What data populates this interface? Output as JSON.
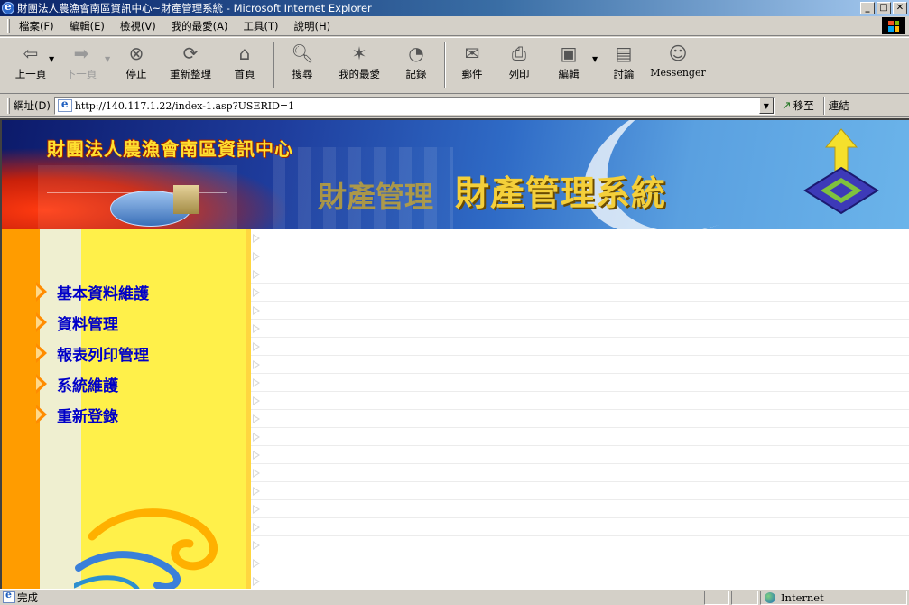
{
  "window": {
    "title": "財團法人農漁會南區資訊中心~財產管理系統 - Microsoft Internet Explorer",
    "controls": {
      "minimize": "_",
      "maximize": "□",
      "close": "✕"
    }
  },
  "menu": {
    "items": [
      "檔案(F)",
      "編輯(E)",
      "檢視(V)",
      "我的最愛(A)",
      "工具(T)",
      "說明(H)"
    ]
  },
  "toolbar": {
    "back": "上一頁",
    "forward": "下一頁",
    "stop": "停止",
    "refresh": "重新整理",
    "home": "首頁",
    "search": "搜尋",
    "favorites": "我的最愛",
    "history": "記錄",
    "mail": "郵件",
    "print": "列印",
    "edit": "編輯",
    "discuss": "討論",
    "messenger": "Messenger"
  },
  "address": {
    "label": "網址(D)",
    "url": "http://140.117.1.22/index-1.asp?USERID=1",
    "go": "移至",
    "links": "連結"
  },
  "banner": {
    "org": "財團法人農漁會南區資訊中心",
    "system_ghost": "財產管理",
    "system": "財產管理系統"
  },
  "sidebar": {
    "items": [
      {
        "label": "基本資料維護"
      },
      {
        "label": "資料管理"
      },
      {
        "label": "報表列印管理"
      },
      {
        "label": "系統維護"
      },
      {
        "label": "重新登錄"
      }
    ]
  },
  "status": {
    "text": "完成",
    "zone": "Internet"
  }
}
